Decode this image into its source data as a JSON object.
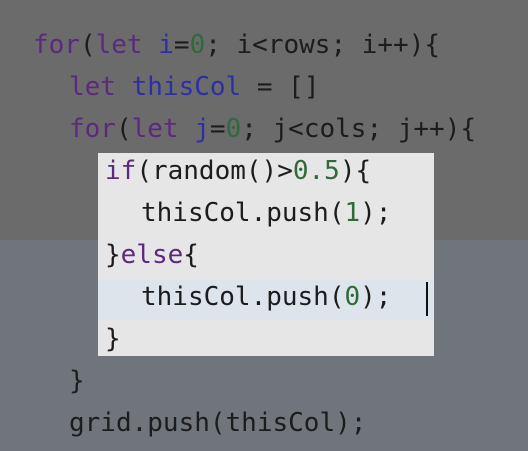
{
  "code": {
    "line1": {
      "kw_for": "for",
      "p1": "(",
      "kw_let": "let",
      "var_i": "i",
      "eq": "=",
      "num0": "0",
      "rest": "; i<rows; i++){"
    },
    "line2": {
      "kw_let": "let",
      "var_thisCol": "thisCol",
      "rest": " = []"
    },
    "line3": {
      "kw_for": "for",
      "p1": "(",
      "kw_let": "let",
      "var_j": "j",
      "eq": "=",
      "num0": "0",
      "rest": "; j<cols; j++){"
    },
    "line4": {
      "kw_if": "if",
      "mid": "(random()>",
      "num": "0.5",
      "rest": "){"
    },
    "line5": {
      "pre": "thisCol.push(",
      "num": "1",
      "post": ");"
    },
    "line6": {
      "brace": "}",
      "kw_else": "else",
      "post": "{"
    },
    "line7": {
      "pre": "thisCol.push(",
      "num": "0",
      "post": ");"
    },
    "line8": {
      "text": "}"
    },
    "line9": {
      "text": "}"
    },
    "line10": {
      "text": "grid.push(thisCol);"
    }
  },
  "colors": {
    "background": "#6a6a6a",
    "selection": "#e6e6e6",
    "keyword": "#5b2a7e",
    "variable": "#2c2fa6",
    "number": "#2f6a3a"
  }
}
